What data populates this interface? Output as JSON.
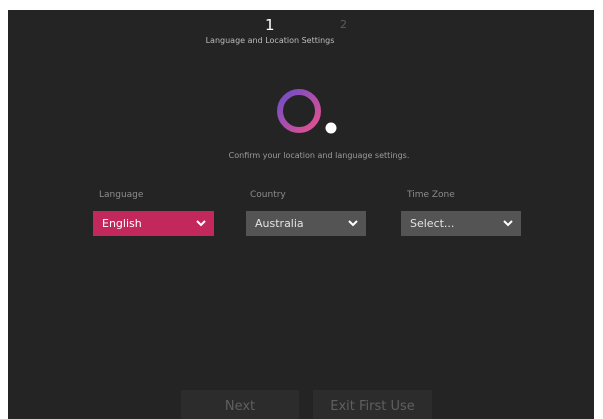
{
  "steps": {
    "current": "1",
    "next": "2"
  },
  "header": {
    "title": "Language and Location Settings"
  },
  "logo": {
    "icon": "lg-logo-icon",
    "gradient": [
      "#6d4ec8",
      "#e8508f"
    ]
  },
  "subtitle": "Confirm your location and language settings.",
  "fields": {
    "language": {
      "label": "Language",
      "value": "English"
    },
    "country": {
      "label": "Country",
      "value": "Australia"
    },
    "timezone": {
      "label": "Time Zone",
      "value": "Select..."
    }
  },
  "buttons": {
    "next": "Next",
    "exit": "Exit First Use"
  },
  "colors": {
    "accent": "#c2285b",
    "background": "#242424",
    "control": "#545454"
  }
}
